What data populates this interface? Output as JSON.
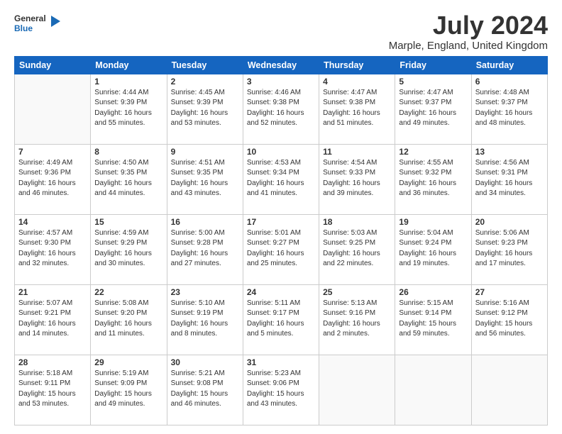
{
  "header": {
    "logo_line1": "General",
    "logo_line2": "Blue",
    "month_year": "July 2024",
    "location": "Marple, England, United Kingdom"
  },
  "days_of_week": [
    "Sunday",
    "Monday",
    "Tuesday",
    "Wednesday",
    "Thursday",
    "Friday",
    "Saturday"
  ],
  "weeks": [
    [
      {
        "num": "",
        "info": ""
      },
      {
        "num": "1",
        "info": "Sunrise: 4:44 AM\nSunset: 9:39 PM\nDaylight: 16 hours\nand 55 minutes."
      },
      {
        "num": "2",
        "info": "Sunrise: 4:45 AM\nSunset: 9:39 PM\nDaylight: 16 hours\nand 53 minutes."
      },
      {
        "num": "3",
        "info": "Sunrise: 4:46 AM\nSunset: 9:38 PM\nDaylight: 16 hours\nand 52 minutes."
      },
      {
        "num": "4",
        "info": "Sunrise: 4:47 AM\nSunset: 9:38 PM\nDaylight: 16 hours\nand 51 minutes."
      },
      {
        "num": "5",
        "info": "Sunrise: 4:47 AM\nSunset: 9:37 PM\nDaylight: 16 hours\nand 49 minutes."
      },
      {
        "num": "6",
        "info": "Sunrise: 4:48 AM\nSunset: 9:37 PM\nDaylight: 16 hours\nand 48 minutes."
      }
    ],
    [
      {
        "num": "7",
        "info": "Sunrise: 4:49 AM\nSunset: 9:36 PM\nDaylight: 16 hours\nand 46 minutes."
      },
      {
        "num": "8",
        "info": "Sunrise: 4:50 AM\nSunset: 9:35 PM\nDaylight: 16 hours\nand 44 minutes."
      },
      {
        "num": "9",
        "info": "Sunrise: 4:51 AM\nSunset: 9:35 PM\nDaylight: 16 hours\nand 43 minutes."
      },
      {
        "num": "10",
        "info": "Sunrise: 4:53 AM\nSunset: 9:34 PM\nDaylight: 16 hours\nand 41 minutes."
      },
      {
        "num": "11",
        "info": "Sunrise: 4:54 AM\nSunset: 9:33 PM\nDaylight: 16 hours\nand 39 minutes."
      },
      {
        "num": "12",
        "info": "Sunrise: 4:55 AM\nSunset: 9:32 PM\nDaylight: 16 hours\nand 36 minutes."
      },
      {
        "num": "13",
        "info": "Sunrise: 4:56 AM\nSunset: 9:31 PM\nDaylight: 16 hours\nand 34 minutes."
      }
    ],
    [
      {
        "num": "14",
        "info": "Sunrise: 4:57 AM\nSunset: 9:30 PM\nDaylight: 16 hours\nand 32 minutes."
      },
      {
        "num": "15",
        "info": "Sunrise: 4:59 AM\nSunset: 9:29 PM\nDaylight: 16 hours\nand 30 minutes."
      },
      {
        "num": "16",
        "info": "Sunrise: 5:00 AM\nSunset: 9:28 PM\nDaylight: 16 hours\nand 27 minutes."
      },
      {
        "num": "17",
        "info": "Sunrise: 5:01 AM\nSunset: 9:27 PM\nDaylight: 16 hours\nand 25 minutes."
      },
      {
        "num": "18",
        "info": "Sunrise: 5:03 AM\nSunset: 9:25 PM\nDaylight: 16 hours\nand 22 minutes."
      },
      {
        "num": "19",
        "info": "Sunrise: 5:04 AM\nSunset: 9:24 PM\nDaylight: 16 hours\nand 19 minutes."
      },
      {
        "num": "20",
        "info": "Sunrise: 5:06 AM\nSunset: 9:23 PM\nDaylight: 16 hours\nand 17 minutes."
      }
    ],
    [
      {
        "num": "21",
        "info": "Sunrise: 5:07 AM\nSunset: 9:21 PM\nDaylight: 16 hours\nand 14 minutes."
      },
      {
        "num": "22",
        "info": "Sunrise: 5:08 AM\nSunset: 9:20 PM\nDaylight: 16 hours\nand 11 minutes."
      },
      {
        "num": "23",
        "info": "Sunrise: 5:10 AM\nSunset: 9:19 PM\nDaylight: 16 hours\nand 8 minutes."
      },
      {
        "num": "24",
        "info": "Sunrise: 5:11 AM\nSunset: 9:17 PM\nDaylight: 16 hours\nand 5 minutes."
      },
      {
        "num": "25",
        "info": "Sunrise: 5:13 AM\nSunset: 9:16 PM\nDaylight: 16 hours\nand 2 minutes."
      },
      {
        "num": "26",
        "info": "Sunrise: 5:15 AM\nSunset: 9:14 PM\nDaylight: 15 hours\nand 59 minutes."
      },
      {
        "num": "27",
        "info": "Sunrise: 5:16 AM\nSunset: 9:12 PM\nDaylight: 15 hours\nand 56 minutes."
      }
    ],
    [
      {
        "num": "28",
        "info": "Sunrise: 5:18 AM\nSunset: 9:11 PM\nDaylight: 15 hours\nand 53 minutes."
      },
      {
        "num": "29",
        "info": "Sunrise: 5:19 AM\nSunset: 9:09 PM\nDaylight: 15 hours\nand 49 minutes."
      },
      {
        "num": "30",
        "info": "Sunrise: 5:21 AM\nSunset: 9:08 PM\nDaylight: 15 hours\nand 46 minutes."
      },
      {
        "num": "31",
        "info": "Sunrise: 5:23 AM\nSunset: 9:06 PM\nDaylight: 15 hours\nand 43 minutes."
      },
      {
        "num": "",
        "info": ""
      },
      {
        "num": "",
        "info": ""
      },
      {
        "num": "",
        "info": ""
      }
    ]
  ]
}
